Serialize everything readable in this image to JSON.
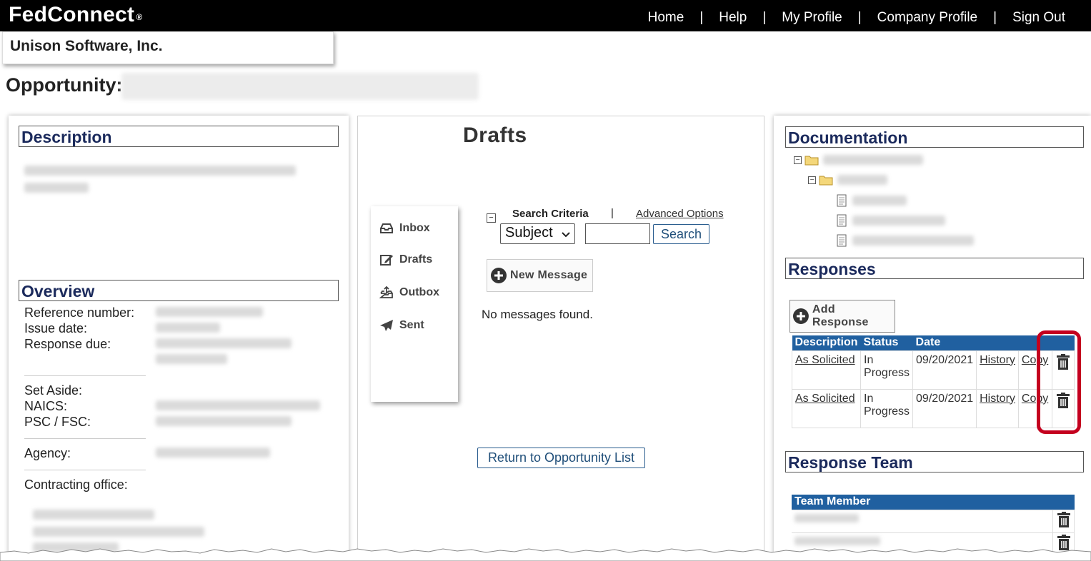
{
  "app": {
    "logo": "FedConnect",
    "logo_mark": "®"
  },
  "nav": {
    "home": "Home",
    "help": "Help",
    "my_profile": "My Profile",
    "company_profile": "Company Profile",
    "sign_out": "Sign Out",
    "separator": "|"
  },
  "company": {
    "name": "Unison Software, Inc."
  },
  "opportunity": {
    "label": "Opportunity:"
  },
  "left": {
    "description_heading": "Description",
    "overview_heading": "Overview",
    "labels": {
      "reference_number": "Reference number:",
      "issue_date": "Issue date:",
      "response_due": "Response due:",
      "set_aside": "Set Aside:",
      "naics": "NAICS:",
      "psc_fsc": "PSC / FSC:",
      "agency": "Agency:",
      "contracting_office": "Contracting office:"
    }
  },
  "mid": {
    "title": "Drafts",
    "mailnav": {
      "inbox": "Inbox",
      "drafts": "Drafts",
      "outbox": "Outbox",
      "sent": "Sent"
    },
    "collapse": "−",
    "search_criteria": "Search Criteria",
    "separator": "|",
    "advanced_options": "Advanced Options",
    "search_field": "Subject",
    "search_button": "Search",
    "new_message": "New Message",
    "no_messages": "No messages found.",
    "return_button": "Return to Opportunity List"
  },
  "right": {
    "documentation_heading": "Documentation",
    "tree_toggle": "−",
    "responses_heading": "Responses",
    "add_response": "Add Response",
    "responses_table": {
      "headers": [
        "Description",
        "Status",
        "Date"
      ],
      "rows": [
        {
          "description": "As Solicited",
          "status": "In Progress",
          "date": "09/20/2021",
          "history": "History",
          "copy": "Copy"
        },
        {
          "description": "As Solicited",
          "status": "In Progress",
          "date": "09/20/2021",
          "history": "History",
          "copy": "Copy"
        }
      ]
    },
    "response_team_heading": "Response Team",
    "team_table": {
      "headers": [
        "Team Member"
      ]
    }
  },
  "colors": {
    "header_bg": "#000000",
    "table_header": "#2060a0",
    "heading_text": "#1b2a5c",
    "highlight": "#c4001f"
  }
}
